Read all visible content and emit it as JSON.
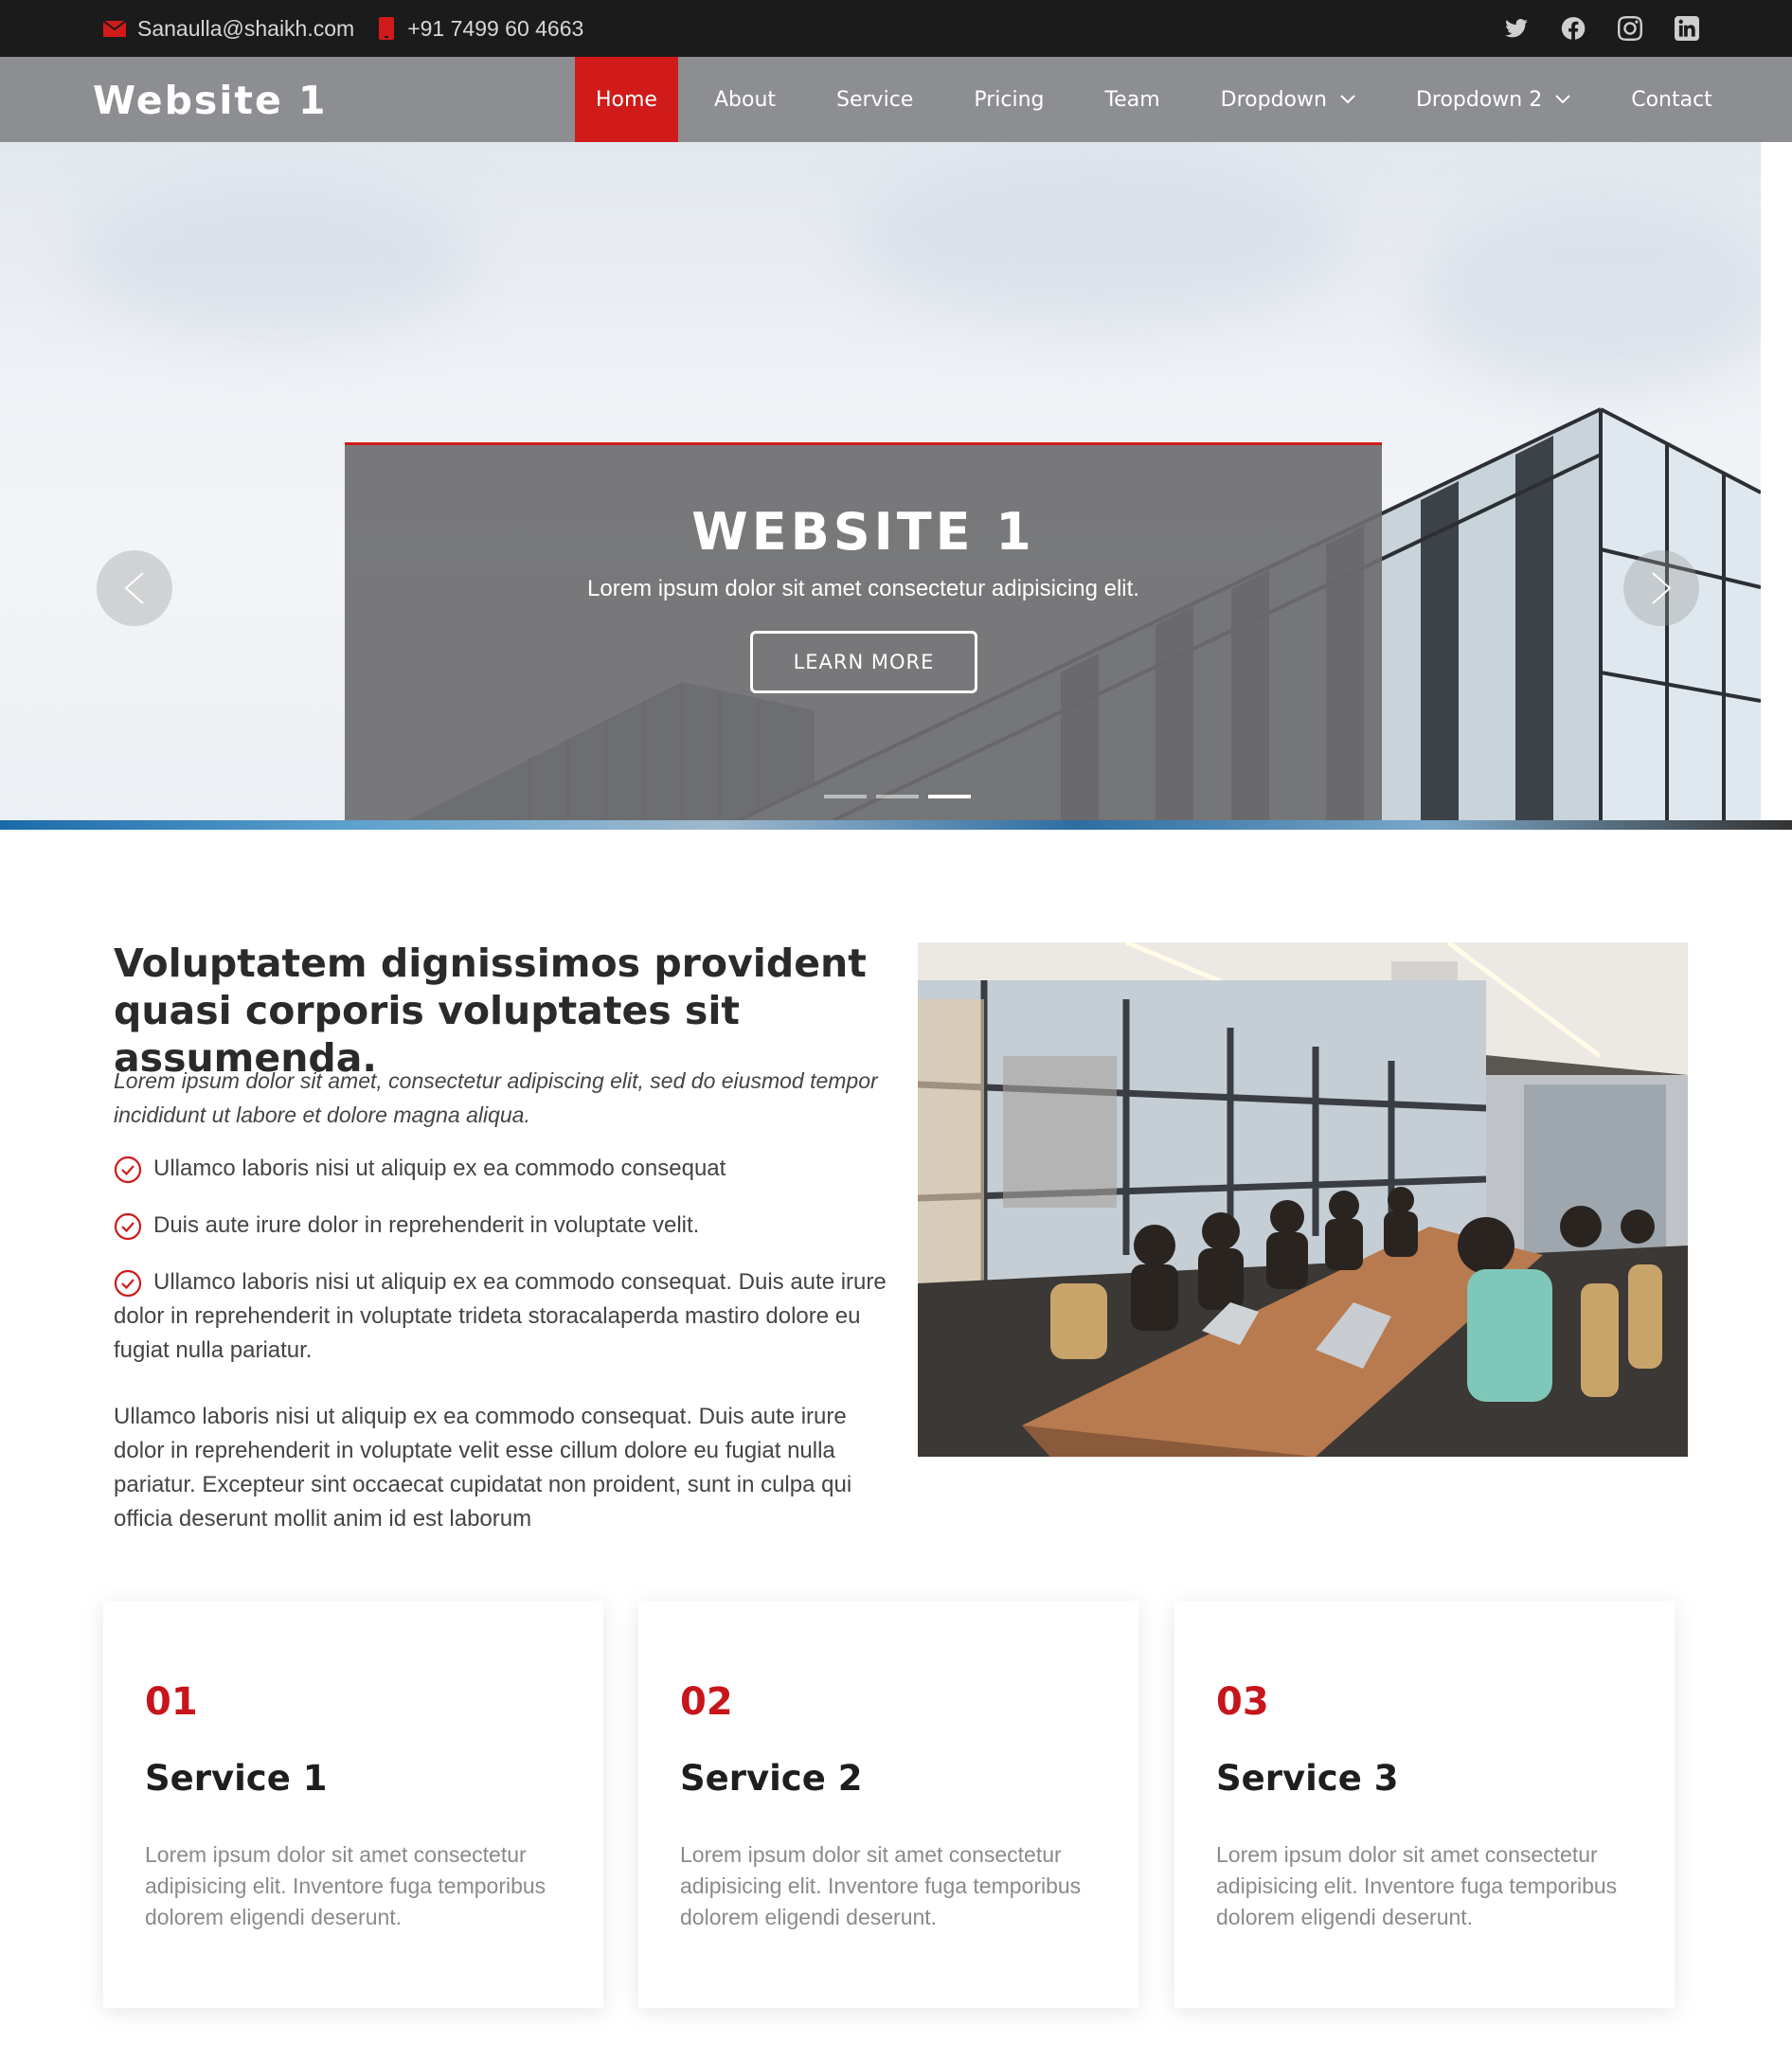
{
  "topbar": {
    "email": "Sanaulla@shaikh.com",
    "phone": "+91 7499 60 4663",
    "socials": [
      "twitter-icon",
      "facebook-icon",
      "instagram-icon",
      "linkedin-icon"
    ]
  },
  "header": {
    "logo": "Website 1",
    "nav": [
      {
        "label": "Home",
        "active": true
      },
      {
        "label": "About"
      },
      {
        "label": "Service"
      },
      {
        "label": "Pricing"
      },
      {
        "label": "Team"
      },
      {
        "label": "Dropdown",
        "has_dropdown": true
      },
      {
        "label": "Dropdown 2",
        "has_dropdown": true
      },
      {
        "label": "Contact"
      }
    ]
  },
  "hero": {
    "title": "WEBSITE 1",
    "subtitle": "Lorem ipsum dolor sit amet consectetur adipisicing elit.",
    "button": "LEARN MORE",
    "slide_count": 3,
    "active_slide": 3
  },
  "about": {
    "title": "Voluptatem dignissimos provident quasi corporis voluptates sit assumenda.",
    "lead": "Lorem ipsum dolor sit amet, consectetur adipiscing elit, sed do eiusmod tempor incididunt ut labore et dolore magna aliqua.",
    "items": [
      "Ullamco laboris nisi ut aliquip ex ea commodo consequat",
      "Duis aute irure dolor in reprehenderit in voluptate velit.",
      "Ullamco laboris nisi ut aliquip ex ea commodo consequat. Duis aute irure dolor in reprehenderit in voluptate trideta storacalaperda mastiro dolore eu fugiat nulla pariatur."
    ],
    "paragraph": "Ullamco laboris nisi ut aliquip ex ea commodo consequat. Duis aute irure dolor in reprehenderit in voluptate velit esse cillum dolore eu fugiat nulla pariatur. Excepteur sint occaecat cupidatat non proident, sunt in culpa qui officia deserunt mollit anim id est laborum"
  },
  "services": [
    {
      "num": "01",
      "title": "Service 1",
      "text": "Lorem ipsum dolor sit amet consectetur adipisicing elit. Inventore fuga temporibus dolorem eligendi deserunt."
    },
    {
      "num": "02",
      "title": "Service 2",
      "text": "Lorem ipsum dolor sit amet consectetur adipisicing elit. Inventore fuga temporibus dolorem eligendi deserunt."
    },
    {
      "num": "03",
      "title": "Service 3",
      "text": "Lorem ipsum dolor sit amet consectetur adipisicing elit. Inventore fuga temporibus dolorem eligendi deserunt."
    }
  ],
  "colors": {
    "accent": "#d11a1a",
    "topbar": "#1b1b1b",
    "header": "#8d8e92"
  }
}
